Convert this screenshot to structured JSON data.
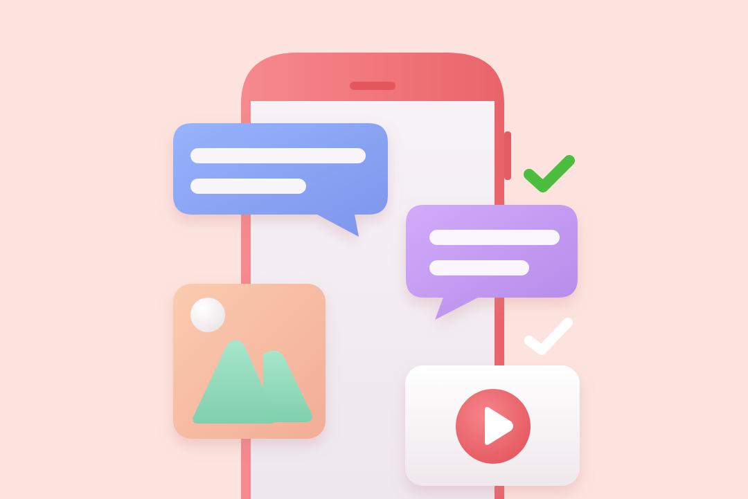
{
  "scene": {
    "subject": "3d-phone-messaging-illustration",
    "colors": {
      "background": "#fde3de",
      "phone_body": "#f1767b",
      "phone_screen": "#f3eef2",
      "blue_bubble": "#8aa6f3",
      "purple_bubble": "#c59cf2",
      "image_tile": "#f8c2a6",
      "mountain": "#8fd8b9",
      "video_card": "#f8f4f6",
      "play_button": "#ee6b72",
      "check_green": "#4bbd3f",
      "check_white": "#ffffff"
    },
    "icons": [
      "smartphone-icon",
      "chat-bubble-icon",
      "image-icon",
      "video-play-icon",
      "checkmark-icon"
    ]
  }
}
